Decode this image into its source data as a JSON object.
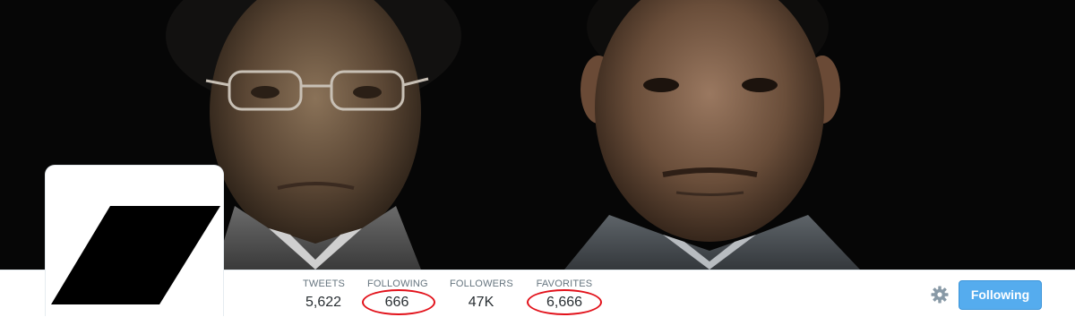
{
  "profile": {
    "stats": [
      {
        "label": "TWEETS",
        "value": "5,622"
      },
      {
        "label": "FOLLOWING",
        "value": "666",
        "circled": true
      },
      {
        "label": "FOLLOWERS",
        "value": "47K"
      },
      {
        "label": "FAVORITES",
        "value": "6,666",
        "circled": true
      }
    ],
    "follow_button": {
      "label": "Following"
    },
    "settings_icon": "gear-icon",
    "avatar_icon": "black-parallelogram-logo"
  },
  "colors": {
    "accent": "#55acee",
    "annotation": "#e2121b",
    "header_background": "#070707",
    "label": "#66757f",
    "value": "#292f33"
  }
}
